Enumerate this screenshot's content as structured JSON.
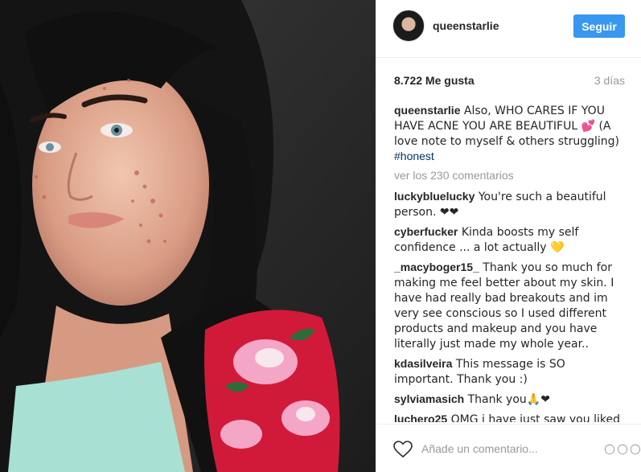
{
  "post": {
    "username": "queenstarlie",
    "follow_label": "Seguir",
    "likes": "8.722 Me gusta",
    "age": "3 días",
    "caption_user": "queenstarlie",
    "caption_text": " Also, WHO CARES IF YOU HAVE ACNE YOU ARE BEAUTIFUL 💕 (A love note to myself & others struggling) ",
    "caption_hashtag": "#honest",
    "view_all": "ver los 230 comentarios"
  },
  "comments": [
    {
      "user": "luckybluelucky",
      "text": " You're such a beautiful person. ❤❤"
    },
    {
      "user": "cyberfucker",
      "text": " Kinda boosts my self confidence ... a lot actually 💛"
    },
    {
      "user": "_macyboger15_",
      "text": " Thank you so much for making me feel better about my skin. I have had really bad breakouts and im very see conscious so I used different products and makeup and you have literally just made my whole year.."
    },
    {
      "user": "kdasilveira",
      "text": " This message is SO important. Thank you :)"
    },
    {
      "user": "sylviamasich",
      "text": " Thank you🙏❤"
    },
    {
      "user": "luchero25",
      "text": " OMG i have just saw you liked"
    }
  ],
  "footer": {
    "placeholder": "Añade un comentario...",
    "more_label": "○○○"
  },
  "colors": {
    "accent": "#3897f0",
    "muted": "#999999",
    "hashtag": "#003569"
  },
  "icons": [
    "heart-icon",
    "more-options-icon",
    "avatar"
  ]
}
